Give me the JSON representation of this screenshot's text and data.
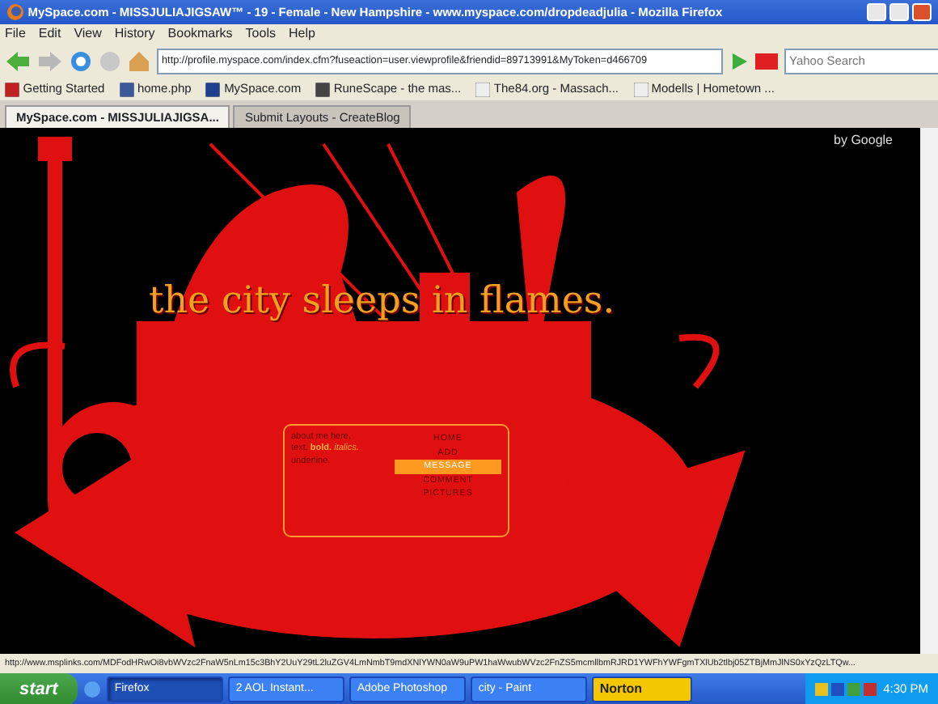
{
  "window": {
    "title": "MySpace.com - MISSJULIAJIGSAW™ - 19 - Female - New Hampshire - www.myspace.com/dropdeadjulia - Mozilla Firefox"
  },
  "menu": [
    "File",
    "Edit",
    "View",
    "History",
    "Bookmarks",
    "Tools",
    "Help"
  ],
  "address": {
    "value": "http://profile.myspace.com/index.cfm?fuseaction=user.viewprofile&friendid=89713991&MyToken=d466709"
  },
  "search": {
    "placeholder": "Yahoo Search"
  },
  "bookmarks": [
    "Getting Started",
    "home.php",
    "MySpace.com",
    "RuneScape - the mas...",
    "The84.org - Massach...",
    "Modells | Hometown ..."
  ],
  "tabs": [
    {
      "label": "MySpace.com - MISSJULIAJIGSA...",
      "selected": true
    },
    {
      "label": "Submit Layouts - CreateBlog",
      "selected": false
    }
  ],
  "page": {
    "google": "by Google",
    "headline": "the city sleeps in flames.",
    "about": [
      "about me here.",
      "text. **bold.** *italics.*",
      "underline."
    ],
    "nav": [
      {
        "label": "HOME",
        "selected": false
      },
      {
        "label": "ADD",
        "selected": false
      },
      {
        "label": "MESSAGE",
        "selected": true
      },
      {
        "label": "COMMENT",
        "selected": false
      },
      {
        "label": "PICTURES",
        "selected": false
      }
    ]
  },
  "status_bar": "http://www.msplinks.com/MDFodHRwOi8vbWVzc2FnaW5nLm15c3BhY2UuY29tL2luZGV4LmNmbT9mdXNlYWN0aW9uPW1haWwubWVzc2FnZS5mcmllbmRJRD1YWFhYWFgmTXlUb2tlbj05ZTBjMmJlNS0xYzQzLTQw...",
  "taskbar": {
    "start": "start",
    "items": [
      {
        "label": "Firefox",
        "selected": true
      },
      {
        "label": "2 AOL Instant...",
        "selected": false
      },
      {
        "label": "Adobe Photoshop",
        "selected": false
      },
      {
        "label": "city - Paint",
        "selected": false
      },
      {
        "label": "Norton",
        "selected": false
      }
    ],
    "clock": "4:30 PM"
  }
}
